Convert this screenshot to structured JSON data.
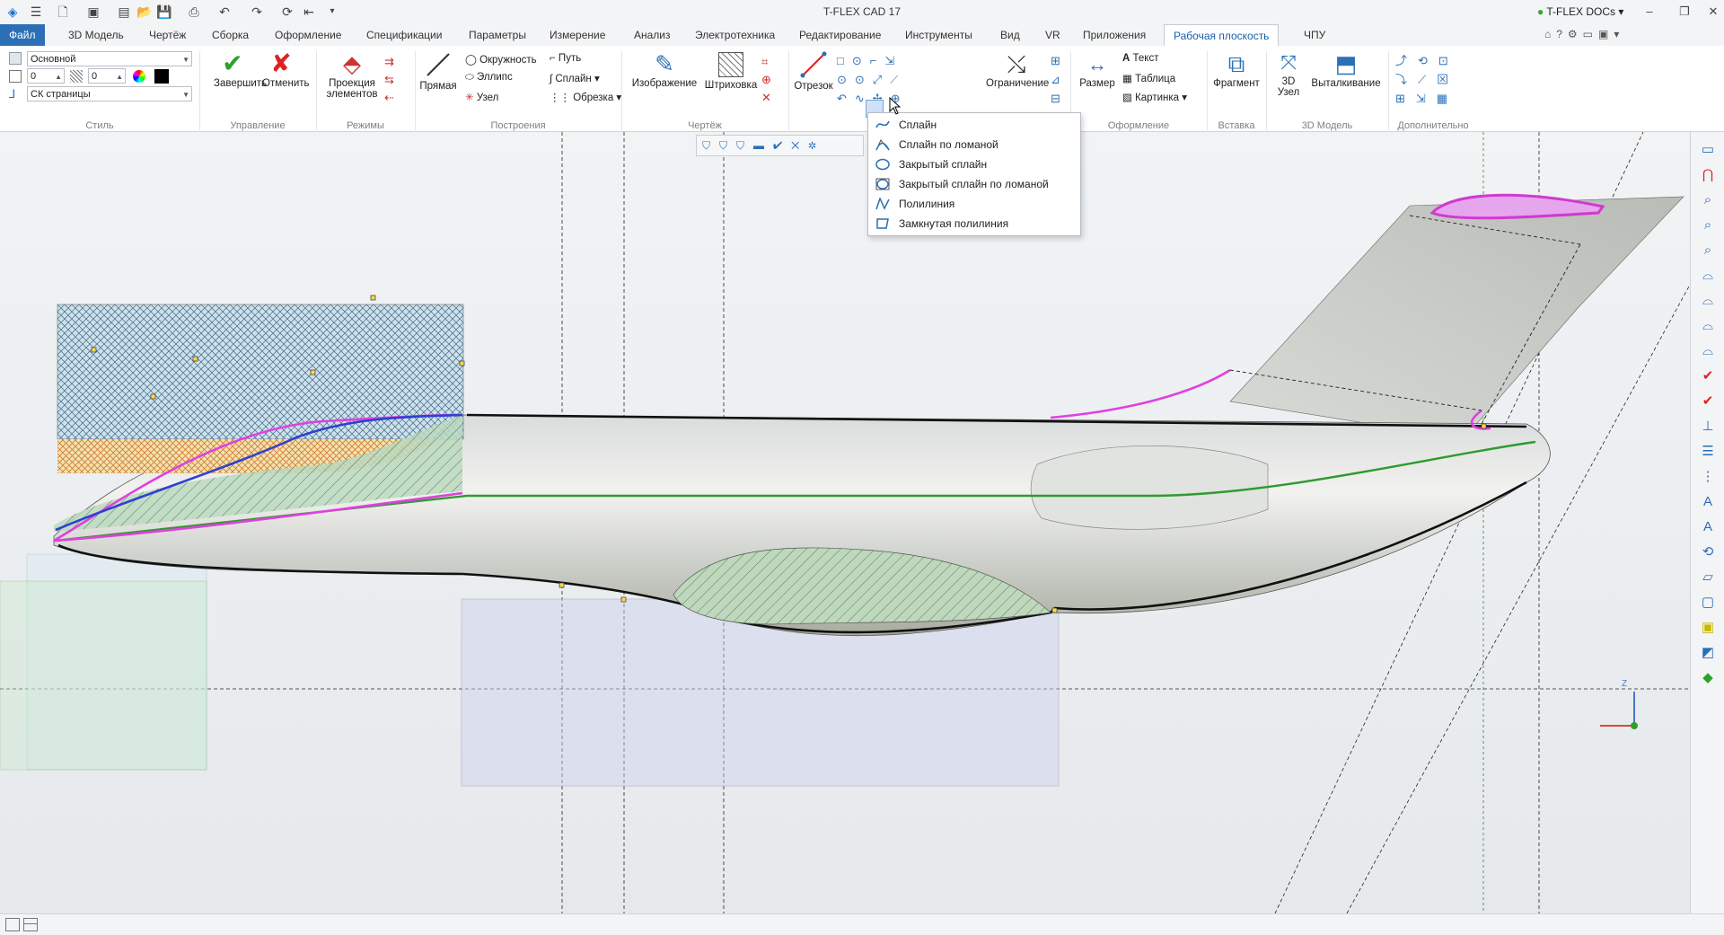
{
  "window": {
    "title": "T-FLEX CAD 17",
    "docs_label": "T-FLEX DOCs"
  },
  "menu": {
    "tabs": [
      "Файл",
      "3D Модель",
      "Чертёж",
      "Сборка",
      "Оформление",
      "Спецификации",
      "Параметры",
      "Измерение",
      "Анализ",
      "Электротехника",
      "Редактирование",
      "Инструменты",
      "Вид",
      "VR",
      "Приложения",
      "Рабочая плоскость",
      "ЧПУ"
    ],
    "active": "Рабочая плоскость"
  },
  "ribbon": {
    "style": {
      "layer": "Основной",
      "val1": "0",
      "val2": "0",
      "cs": "СК страницы",
      "group": "Стиль"
    },
    "manage": {
      "finish": "Завершить",
      "cancel": "Отменить",
      "group": "Управление"
    },
    "modes": {
      "projection": "Проекция элементов",
      "group": "Режимы"
    },
    "build": {
      "line": "Прямая",
      "circle": "Окружность",
      "ellipse": "Эллипс",
      "node": "Узел",
      "path": "Путь",
      "spline": "Сплайн",
      "trim": "Обрезка",
      "group": "Построения"
    },
    "drawing": {
      "image": "Изображение",
      "hatch": "Штриховка",
      "group": "Чертёж"
    },
    "segment": {
      "label": "Отрезок"
    },
    "constraint": {
      "label": "Ограничение"
    },
    "design": {
      "size": "Размер",
      "text": "Текст",
      "table": "Таблица",
      "picture": "Картинка",
      "group": "Оформление"
    },
    "insert": {
      "fragment": "Фрагмент",
      "group": "Вставка"
    },
    "model3d": {
      "node": "3D Узел",
      "extrude": "Выталкивание",
      "group": "3D Модель"
    },
    "extra": {
      "group": "Дополнительно"
    }
  },
  "dropdown": {
    "items": [
      "Сплайн",
      "Сплайн по ломаной",
      "Закрытый сплайн",
      "Закрытый сплайн по ломаной",
      "Полилиния",
      "Замкнутая полилиния"
    ]
  },
  "colors": {
    "accent": "#2b6fb6",
    "spline": "#e040e0",
    "bluespline": "#3040d0",
    "centerline": "#2f9a2f"
  },
  "triad": {
    "z": "Z"
  }
}
